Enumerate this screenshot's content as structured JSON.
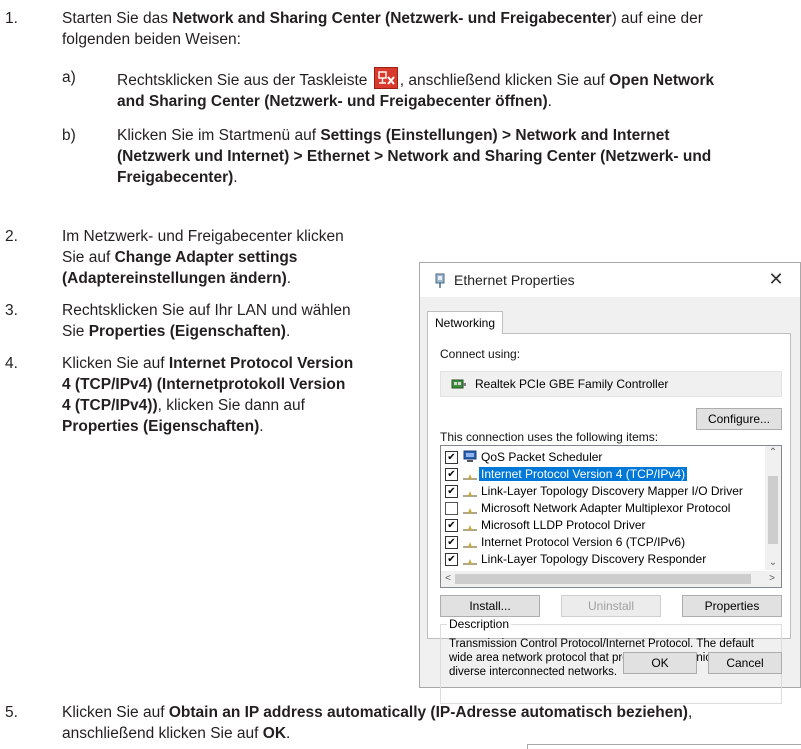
{
  "steps": {
    "s1": {
      "num": "1.",
      "pre": "Starten Sie das ",
      "bold": "Network and Sharing Center (Netzwerk- und Freigabecenter",
      "post": ") auf eine der",
      "line2": "folgenden beiden Weisen:"
    },
    "sa": {
      "letter": "a)",
      "pre": "Rechtsklicken Sie aus der Taskleiste ",
      "mid": ", anschließend klicken Sie auf ",
      "bold1": "Open Network",
      "bold2": "and Sharing Center (Netzwerk- und Freigabecenter öffnen)",
      "post": "."
    },
    "sb": {
      "letter": "b)",
      "pre": "Klicken Sie im Startmenü auf ",
      "bold1": "Settings (Einstellungen) > Network and Internet",
      "bold2": "(Netzwerk und Internet) > Ethernet > Network and Sharing Center (Netzwerk- und",
      "bold3": "Freigabecenter)",
      "post": "."
    },
    "s2": {
      "num": "2.",
      "l1": "Im Netzwerk- und Freigabecenter klicken",
      "l2": "Sie auf ",
      "b2": "Change Adapter settings",
      "b3": "(Adaptereinstellungen ändern)",
      "post": "."
    },
    "s3": {
      "num": "3.",
      "l1": "Rechtsklicken Sie auf Ihr LAN und wählen",
      "l2": "Sie ",
      "b2": "Properties (Eigenschaften)",
      "post": "."
    },
    "s4": {
      "num": "4.",
      "l1": "Klicken Sie auf ",
      "b1": "Internet Protocol Version",
      "b2": "4 (TCP/IPv4) (Internetprotokoll Version",
      "b3": "4 (TCP/IPv4))",
      "l3": ", klicken Sie dann auf",
      "b4": "Properties (Eigenschaften)",
      "post": "."
    },
    "s5": {
      "num": "5.",
      "pre": "Klicken Sie auf ",
      "bold": "Obtain an IP address automatically (IP-Adresse automatisch beziehen)",
      "post": ",",
      "line2pre": "anschließend klicken Sie auf ",
      "line2bold": "OK",
      "line2post": "."
    }
  },
  "dialog": {
    "title": "Ethernet Properties",
    "close": "✕",
    "tab": "Networking",
    "connect_using": "Connect using:",
    "adapter": "Realtek PCIe GBE Family Controller",
    "configure": "Configure...",
    "items_label": "This connection uses the following items:",
    "items": [
      {
        "label": "QoS Packet Scheduler",
        "checked": "✔",
        "selected": false
      },
      {
        "label": "Internet Protocol Version 4 (TCP/IPv4)",
        "checked": "✔",
        "selected": true
      },
      {
        "label": "Link-Layer Topology Discovery Mapper I/O Driver",
        "checked": "✔",
        "selected": false
      },
      {
        "label": "Microsoft Network Adapter Multiplexor Protocol",
        "checked": "",
        "selected": false
      },
      {
        "label": "Microsoft LLDP Protocol Driver",
        "checked": "✔",
        "selected": false
      },
      {
        "label": "Internet Protocol Version 6 (TCP/IPv6)",
        "checked": "✔",
        "selected": false
      },
      {
        "label": "Link-Layer Topology Discovery Responder",
        "checked": "✔",
        "selected": false
      }
    ],
    "install": "Install...",
    "uninstall": "Uninstall",
    "properties": "Properties",
    "description_label": "Description",
    "description": "Transmission Control Protocol/Internet Protocol. The default wide area network protocol that provides communication across diverse interconnected networks.",
    "ok": "OK",
    "cancel": "Cancel"
  },
  "colors": {
    "selection": "#0078d7",
    "text": "#231f20"
  }
}
